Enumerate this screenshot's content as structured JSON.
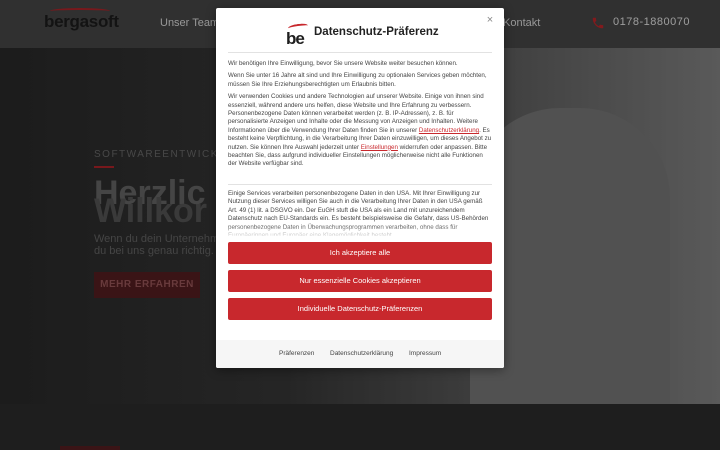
{
  "header": {
    "logo": "bergasoft",
    "nav": {
      "team": "Unser Team",
      "contact": "Kontakt"
    },
    "phone": "0178-1880070"
  },
  "hero": {
    "eyebrow": "SOFTWAREENTWICKLU",
    "title_line_1": "Herzlic",
    "title_line_2": "Willkor",
    "text_line_1": "Wenn du dein Unternehmen",
    "text_line_2": "du bei uns genau richtig. Sie",
    "button": "MEHR ERFAHREN"
  },
  "modal": {
    "logo": "be",
    "title": "Datenschutz-Präferenz",
    "close": "×",
    "paragraph_1": "Wir benötigen Ihre Einwilligung, bevor Sie unsere Website weiter besuchen können.",
    "paragraph_2": "Wenn Sie unter 16 Jahre alt sind und Ihre Einwilligung zu optionalen Services geben möchten, müssen Sie Ihre Erziehungsberechtigten um Erlaubnis bitten.",
    "paragraph_3_a": "Wir verwenden Cookies und andere Technologien auf unserer Website. Einige von ihnen sind essenziell, während andere uns helfen, diese Website und Ihre Erfahrung zu verbessern. Personenbezogene Daten können verarbeitet werden (z. B. IP-Adressen), z. B. für personalisierte Anzeigen und Inhalte oder die Messung von Anzeigen und Inhalten. Weitere Informationen über die Verwendung Ihrer Daten finden Sie in unserer ",
    "paragraph_3_link_1": "Datenschutzerklärung",
    "paragraph_3_b": ". Es besteht keine Verpflichtung, in die Verarbeitung Ihrer Daten einzuwilligen, um dieses Angebot zu nutzen. Sie können Ihre Auswahl jederzeit unter ",
    "paragraph_3_link_2": "Einstellungen",
    "paragraph_3_c": " widerrufen oder anpassen. Bitte beachten Sie, dass aufgrund individueller Einstellungen möglicherweise nicht alle Funktionen der Website verfügbar sind.",
    "paragraph_4": "Einige Services verarbeiten personenbezogene Daten in den USA. Mit Ihrer Einwilligung zur Nutzung dieser Services willigen Sie auch in die Verarbeitung Ihrer Daten in den USA gemäß Art. 49 (1) lit. a DSGVO ein. Der EuGH stuft die USA als ein Land mit unzureichendem Datenschutz nach EU-Standards ein. Es besteht beispielsweise die Gefahr, dass US-Behörden personenbezogene Daten in Überwachungsprogrammen verarbeiten, ohne dass für Europäerinnen und Europäer eine Klagemöglichkeit besteht.",
    "buttons": {
      "accept_all": "Ich akzeptiere alle",
      "essential_only": "Nur essenzielle Cookies akzeptieren",
      "individual": "Individuelle Datenschutz-Präferenzen"
    },
    "footer_links": {
      "preferences": "Präferenzen",
      "privacy": "Datenschutzerklärung",
      "imprint": "Impressum"
    }
  },
  "colors": {
    "accent": "#c8282d",
    "header_bg": "#4a4a4a"
  }
}
